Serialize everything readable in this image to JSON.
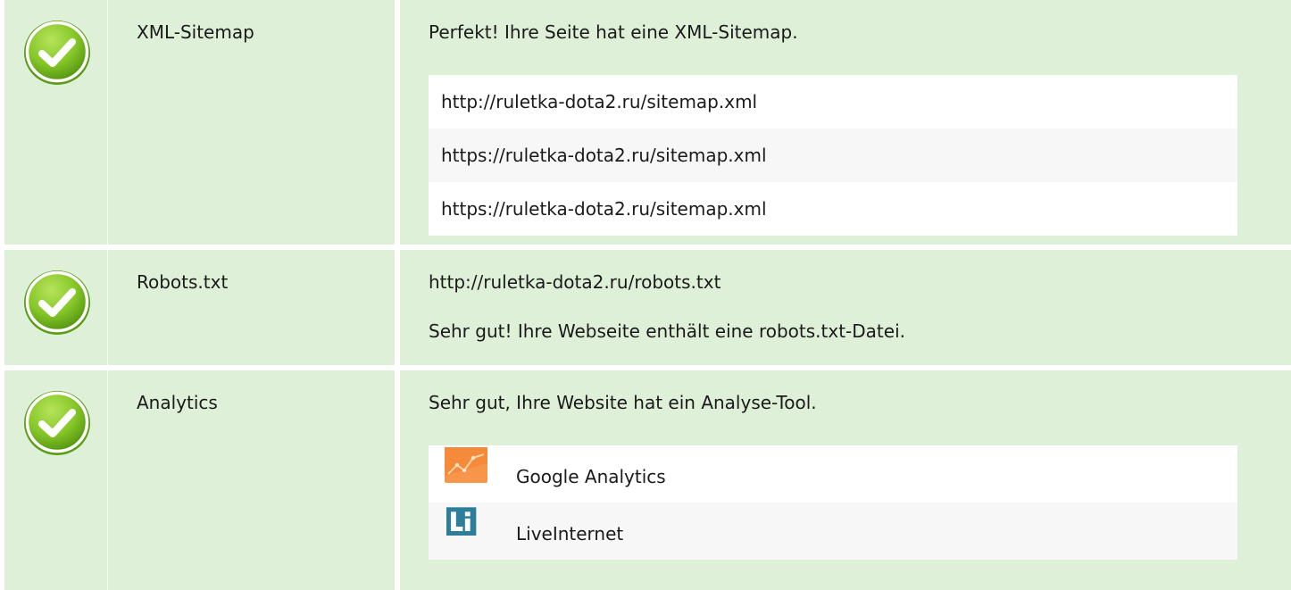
{
  "rows": [
    {
      "name": "XML-Sitemap",
      "status_icon": "check-circle-icon",
      "message": "Perfekt! Ihre Seite hat eine XML-Sitemap.",
      "sitemaps": [
        "http://ruletka-dota2.ru/sitemap.xml",
        "https://ruletka-dota2.ru/sitemap.xml",
        "https://ruletka-dota2.ru/sitemap.xml"
      ]
    },
    {
      "name": "Robots.txt",
      "status_icon": "check-circle-icon",
      "url": "http://ruletka-dota2.ru/robots.txt",
      "message": "Sehr gut! Ihre Webseite enthält eine robots.txt-Datei."
    },
    {
      "name": "Analytics",
      "status_icon": "check-circle-icon",
      "message": "Sehr gut, Ihre Website hat ein Analyse-Tool.",
      "tools": [
        {
          "name": "Google Analytics",
          "icon": "google-analytics-icon"
        },
        {
          "name": "LiveInternet",
          "icon": "liveinternet-icon"
        }
      ]
    }
  ],
  "colors": {
    "row_background": "#dff0d8",
    "check_green": "#7cc41f",
    "list_odd": "#ffffff",
    "list_even": "#f7f7f7"
  }
}
